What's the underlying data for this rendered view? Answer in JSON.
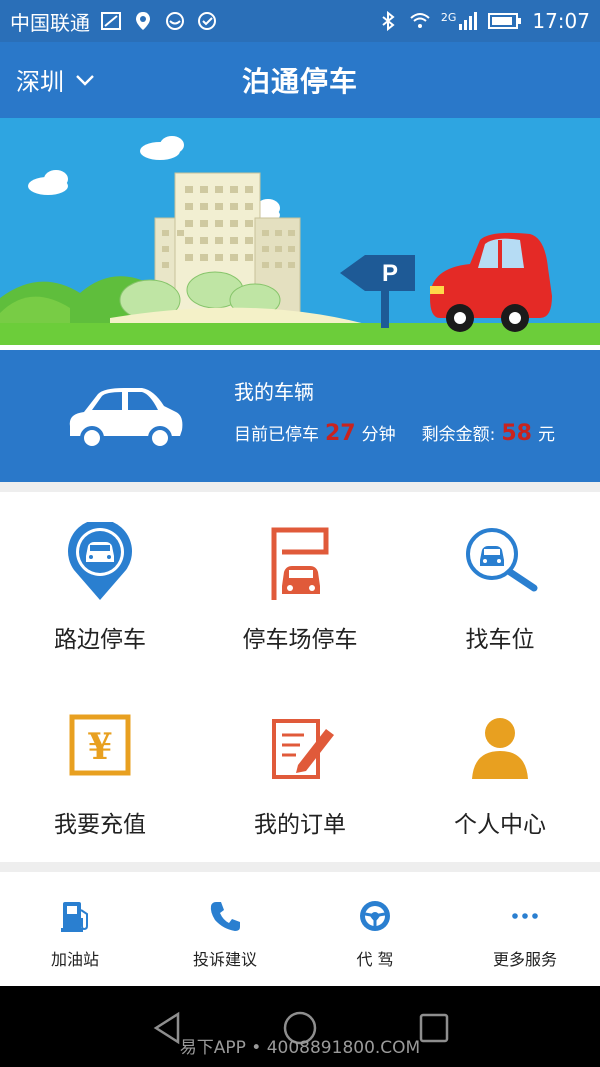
{
  "status_bar": {
    "carrier": "中国联通",
    "network": "2G",
    "time": "17:07"
  },
  "header": {
    "city": "深圳",
    "title": "泊通停车"
  },
  "banner": {
    "parking_sign": "P"
  },
  "vehicle": {
    "title": "我的车辆",
    "parked_prefix": "目前已停车",
    "parked_minutes": "27",
    "parked_unit": "分钟",
    "balance_prefix": "剩余金额:",
    "balance_amount": "58",
    "balance_unit": "元"
  },
  "grid": [
    {
      "label": "路边停车",
      "icon": "roadside-parking-icon"
    },
    {
      "label": "停车场停车",
      "icon": "parking-lot-icon"
    },
    {
      "label": "找车位",
      "icon": "find-spot-icon"
    },
    {
      "label": "我要充值",
      "icon": "recharge-icon"
    },
    {
      "label": "我的订单",
      "icon": "orders-icon"
    },
    {
      "label": "个人中心",
      "icon": "profile-icon"
    }
  ],
  "services": [
    {
      "label": "加油站",
      "icon": "gas-station-icon"
    },
    {
      "label": "投诉建议",
      "icon": "phone-icon"
    },
    {
      "label": "代 驾",
      "icon": "steering-wheel-icon"
    },
    {
      "label": "更多服务",
      "icon": "more-icon"
    }
  ],
  "watermark": "易下APP • 4008891800.COM",
  "colors": {
    "primary_blue": "#2a78c9",
    "accent_red": "#c8231f",
    "icon_blue": "#2a7fd0",
    "icon_orange": "#e8a020",
    "icon_red": "#e05a3a"
  }
}
